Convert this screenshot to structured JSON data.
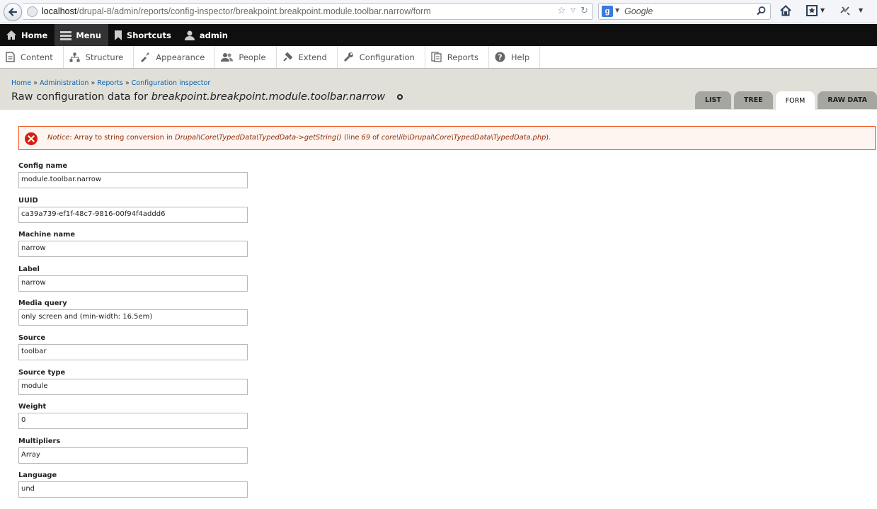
{
  "browser": {
    "url_host": "localhost",
    "url_path": "/drupal-8/admin/reports/config-inspector/breakpoint.breakpoint.module.toolbar.narrow/form",
    "search_engine_icon": "g-icon",
    "search_placeholder": "Google"
  },
  "toolbar": {
    "items": [
      {
        "label": "Home",
        "icon": "home-icon"
      },
      {
        "label": "Menu",
        "icon": "menu-icon"
      },
      {
        "label": "Shortcuts",
        "icon": "bookmark-icon"
      },
      {
        "label": "admin",
        "icon": "user-icon"
      }
    ]
  },
  "tray": {
    "items": [
      {
        "label": "Content",
        "icon": "content-icon"
      },
      {
        "label": "Structure",
        "icon": "structure-icon"
      },
      {
        "label": "Appearance",
        "icon": "appearance-icon"
      },
      {
        "label": "People",
        "icon": "people-icon"
      },
      {
        "label": "Extend",
        "icon": "extend-icon"
      },
      {
        "label": "Configuration",
        "icon": "wrench-icon"
      },
      {
        "label": "Reports",
        "icon": "reports-icon"
      },
      {
        "label": "Help",
        "icon": "help-icon"
      }
    ]
  },
  "breadcrumb": {
    "items": [
      "Home",
      "Administration",
      "Reports",
      "Configuration inspector"
    ],
    "separator": "»"
  },
  "page": {
    "title_prefix": "Raw configuration data for",
    "title_config": "breakpoint.breakpoint.module.toolbar.narrow"
  },
  "tabs": [
    {
      "label": "LIST",
      "active": false
    },
    {
      "label": "TREE",
      "active": false
    },
    {
      "label": "FORM",
      "active": true
    },
    {
      "label": "RAW DATA",
      "active": false
    }
  ],
  "notice": {
    "label": "Notice",
    "text_1": ": Array to string conversion in ",
    "func": "Drupal\\Core\\TypedData\\TypedData->getString()",
    "text_2": " (line ",
    "line": "69",
    "text_3": " of ",
    "file": "core\\lib\\Drupal\\Core\\TypedData\\TypedData.php",
    "text_4": ")."
  },
  "form": {
    "fields": [
      {
        "label": "Config name",
        "value": "module.toolbar.narrow"
      },
      {
        "label": "UUID",
        "value": "ca39a739-ef1f-48c7-9816-00f94f4addd6"
      },
      {
        "label": "Machine name",
        "value": "narrow"
      },
      {
        "label": "Label",
        "value": "narrow"
      },
      {
        "label": "Media query",
        "value": "only screen and (min-width: 16.5em)"
      },
      {
        "label": "Source",
        "value": "toolbar"
      },
      {
        "label": "Source type",
        "value": "module"
      },
      {
        "label": "Weight",
        "value": "0"
      },
      {
        "label": "Multipliers",
        "value": "Array"
      },
      {
        "label": "Language",
        "value": "und"
      }
    ]
  },
  "colors": {
    "toolbar_bg": "#0f0f0f",
    "header_bg": "#e0e0d8",
    "link": "#0a63b3",
    "notice_border": "#ed541d",
    "notice_text": "#8c2e0b"
  }
}
